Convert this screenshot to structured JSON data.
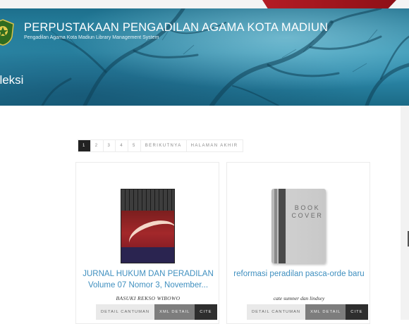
{
  "header": {
    "title": "PERPUSTAKAAN PENGADILAN AGAMA KOTA MADIUN",
    "subtitle": "Pengadilan Agama Kota Madiun Library Management System",
    "section": "oleksi",
    "logo_icon": "court-emblem-icon"
  },
  "pagination": {
    "pages": [
      "1",
      "2",
      "3",
      "4",
      "5"
    ],
    "active": "1",
    "next_label": "BERIKUTNYA",
    "last_label": "HALAMAN AKHIR"
  },
  "items": [
    {
      "title": "JURNAL HUKUM DAN PERADILAN Volume 07 Nomor 3, November...",
      "author": "BASUKI REKSO WIBOWO",
      "cover": "journal-cover-image",
      "buttons": {
        "detail": "DETAIL CANTUMAN",
        "xml": "XML DETAIL",
        "cite": "CITE"
      }
    },
    {
      "title": "reformasi peradilan pasca-orde baru",
      "author": "cate sumner dan lindsey",
      "cover": "book-cover-placeholder",
      "cover_text": "BOOK COVER",
      "buttons": {
        "detail": "DETAIL CANTUMAN",
        "xml": "XML DETAIL",
        "cite": "CITE"
      }
    }
  ],
  "colors": {
    "banner": "#2b87a8",
    "link": "#3f8fbf",
    "active_page": "#222222"
  }
}
